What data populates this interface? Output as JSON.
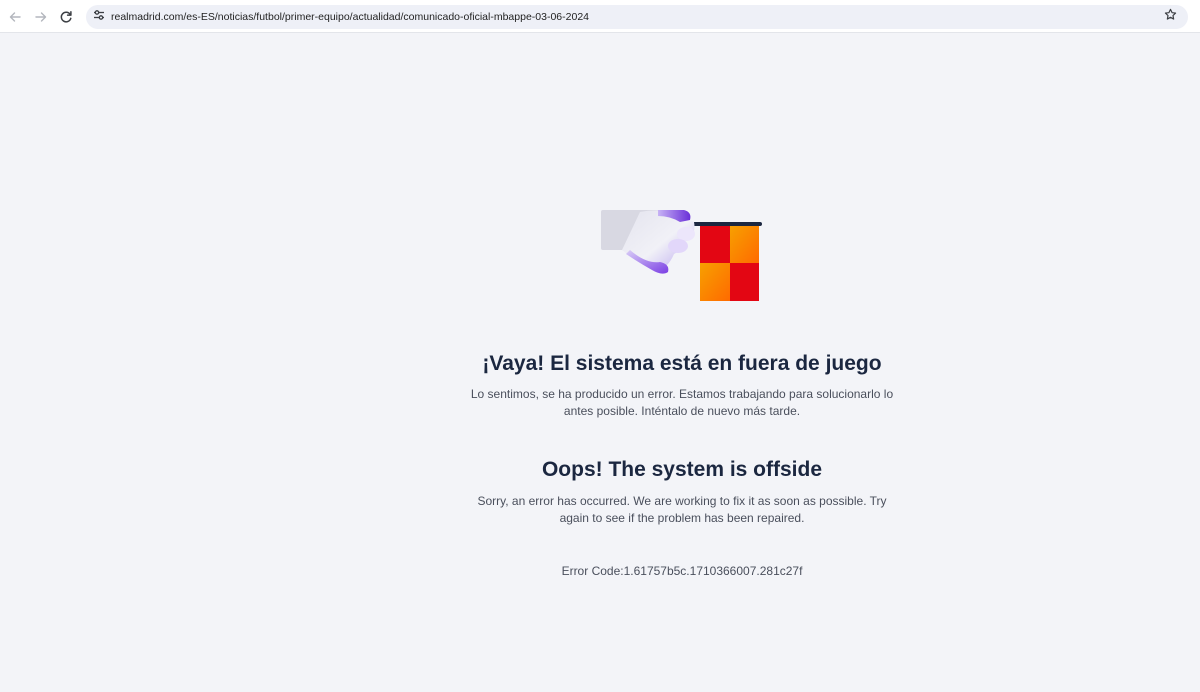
{
  "browser": {
    "url": "realmadrid.com/es-ES/noticias/futbol/primer-equipo/actualidad/comunicado-oficial-mbappe-03-06-2024",
    "icons": {
      "back": "arrow-left-icon",
      "forward": "arrow-right-icon",
      "reload": "reload-icon",
      "site_info": "tune-icon",
      "bookmark": "star-icon"
    }
  },
  "error_page": {
    "illustration": "referee-flag-icon",
    "title_es": "¡Vaya! El sistema está en fuera de juego",
    "message_es": "Lo sentimos, se ha producido un error. Estamos trabajando para solucionarlo lo antes posible. Inténtalo de nuevo más tarde.",
    "title_en": "Oops! The system is offside",
    "message_en": "Sorry, an error has occurred. We are working to fix it as soon as possible. Try again to see if the problem has been repaired.",
    "error_code": "Error Code:1.61757b5c.1710366007.281c27f"
  },
  "colors": {
    "background": "#f3f4f8",
    "title": "#1b2740",
    "text": "#4a4f5c",
    "flag_red": "#e30613",
    "flag_yellow": "#fbb800",
    "accent_purple": "#7b3fe4"
  }
}
